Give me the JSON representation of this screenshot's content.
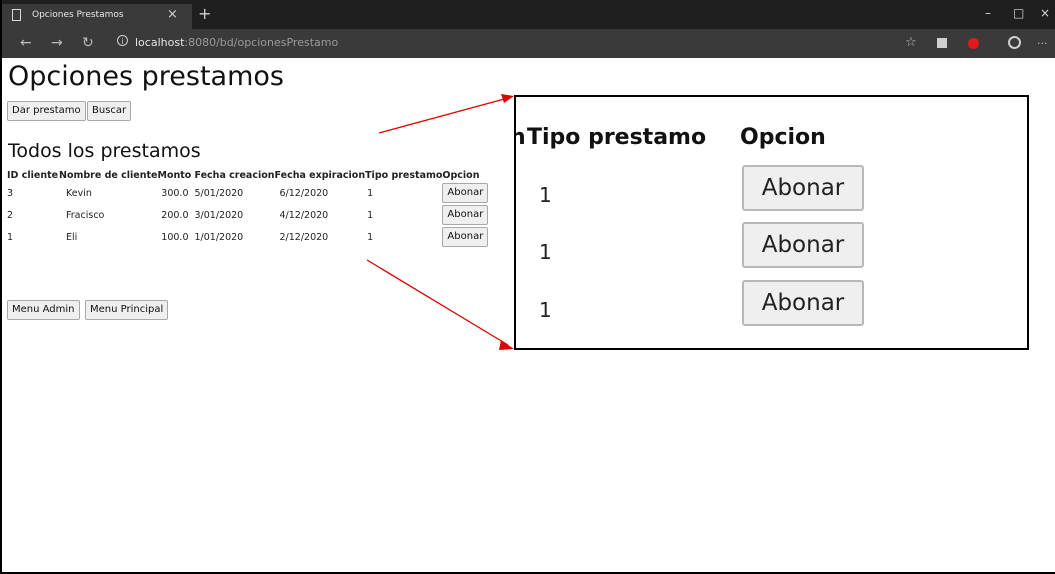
{
  "browser": {
    "tab_title": "Opciones Prestamos",
    "close_glyph": "×",
    "new_tab_glyph": "+",
    "url_host": "localhost",
    "url_path": ":8080/bd/opcionesPrestamo",
    "nav": {
      "back": "←",
      "forward": "→",
      "refresh": "↻"
    },
    "window_controls": {
      "minimize": "–",
      "maximize": "□",
      "close": "×"
    },
    "toolbar_icons": [
      "star-icon",
      "extension-icon",
      "opera-icon",
      "account-icon",
      "more-icon"
    ],
    "more_glyph": "···",
    "star_glyph": "☆"
  },
  "page": {
    "title": "Opciones prestamos",
    "top_buttons": [
      "Dar prestamo",
      "Buscar"
    ],
    "section_title": "Todos los prestamos",
    "table": {
      "headers": [
        "ID cliente",
        "Nombre de cliente",
        "Monto",
        "Fecha creacion",
        "Fecha expiracion",
        "Tipo prestamo",
        "Opcion"
      ],
      "rows": [
        {
          "id": "3",
          "name": "Kevin",
          "amount": "300.0",
          "created": "5/01/2020",
          "expires": "6/12/2020",
          "type": "1",
          "action": "Abonar"
        },
        {
          "id": "2",
          "name": "Fracisco",
          "amount": "200.0",
          "created": "3/01/2020",
          "expires": "4/12/2020",
          "type": "1",
          "action": "Abonar"
        },
        {
          "id": "1",
          "name": "Eli",
          "amount": "100.0",
          "created": "1/01/2020",
          "expires": "2/12/2020",
          "type": "1",
          "action": "Abonar"
        }
      ]
    },
    "bottom_buttons": [
      "Menu Admin",
      "Menu Principal"
    ]
  },
  "zoom_inset": {
    "partial_header": "n",
    "headers": [
      "Tipo prestamo",
      "Opcion"
    ],
    "rows": [
      {
        "type": "1",
        "action": "Abonar"
      },
      {
        "type": "1",
        "action": "Abonar"
      },
      {
        "type": "1",
        "action": "Abonar"
      }
    ]
  },
  "colors": {
    "chrome_dark": "#1f1f1f",
    "chrome_mid": "#3a3a3a",
    "arrow": "#e00000",
    "opera_red": "#e01a1a"
  }
}
